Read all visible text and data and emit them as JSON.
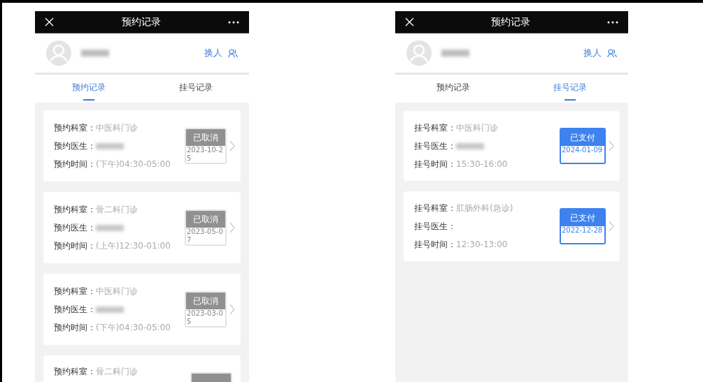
{
  "phones": [
    {
      "title": "预约记录",
      "switch_label": "换人",
      "tabs": [
        {
          "label": "预约记录",
          "selected": true
        },
        {
          "label": "挂号记录",
          "selected": false
        }
      ],
      "records": [
        {
          "fields": [
            {
              "label": "预约科室：",
              "kind": "text",
              "value": "中医科门诊"
            },
            {
              "label": "预约医生：",
              "kind": "redacted"
            },
            {
              "label": "预约时间：",
              "kind": "text",
              "value": "(下午)04:30-05:00"
            }
          ],
          "status": {
            "kind": "cancelled",
            "label": "已取消",
            "date": "2023-10-25"
          }
        },
        {
          "fields": [
            {
              "label": "预约科室：",
              "kind": "text",
              "value": "骨二科门诊"
            },
            {
              "label": "预约医生：",
              "kind": "redacted"
            },
            {
              "label": "预约时间：",
              "kind": "text",
              "value": "(上午)12:30-01:00"
            }
          ],
          "status": {
            "kind": "cancelled",
            "label": "已取消",
            "date": "2023-05-07"
          }
        },
        {
          "fields": [
            {
              "label": "预约科室：",
              "kind": "text",
              "value": "中医科门诊"
            },
            {
              "label": "预约医生：",
              "kind": "redacted"
            },
            {
              "label": "预约时间：",
              "kind": "text",
              "value": "(下午)04:30-05:00"
            }
          ],
          "status": {
            "kind": "cancelled",
            "label": "已取消",
            "date": "2023-03-05"
          }
        },
        {
          "fields": [
            {
              "label": "预约科室：",
              "kind": "text",
              "value": "骨二科门诊"
            }
          ],
          "status": {
            "kind": "cancelled"
          }
        }
      ]
    },
    {
      "title": "预约记录",
      "switch_label": "换人",
      "tabs": [
        {
          "label": "预约记录",
          "selected": false
        },
        {
          "label": "挂号记录",
          "selected": true
        }
      ],
      "records": [
        {
          "fields": [
            {
              "label": "挂号科室：",
              "kind": "text",
              "value": "中医科门诊"
            },
            {
              "label": "挂号医生：",
              "kind": "redacted"
            },
            {
              "label": "挂号时间：",
              "kind": "text",
              "value": "15:30-16:00"
            }
          ],
          "status": {
            "kind": "paid",
            "label": "已支付",
            "date": "2024-01-09"
          }
        },
        {
          "fields": [
            {
              "label": "挂号科室：",
              "kind": "text",
              "value": "肛肠外科(急诊)"
            },
            {
              "label": "挂号医生：",
              "kind": "empty"
            },
            {
              "label": "挂号时间：",
              "kind": "text",
              "value": "12:30-13:00"
            }
          ],
          "status": {
            "kind": "paid",
            "label": "已支付",
            "date": "2022-12-28"
          }
        }
      ]
    }
  ]
}
